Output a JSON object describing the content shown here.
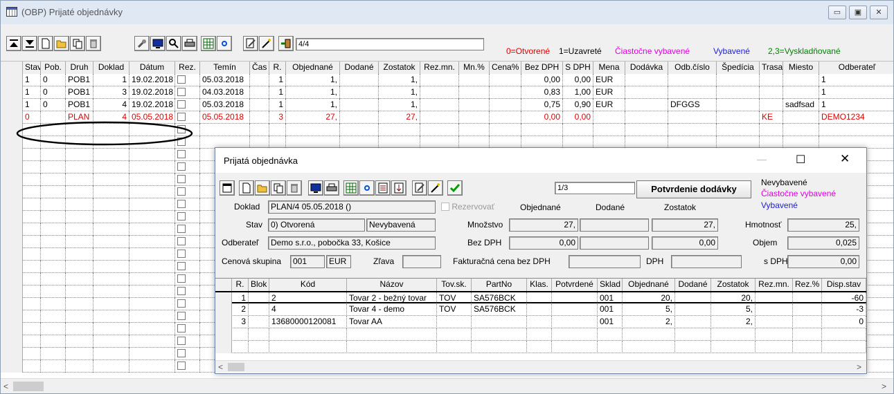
{
  "window": {
    "title": "(OBP) Prijaté objednávky",
    "icon": "table-window-icon"
  },
  "toolbar": {
    "counter": "4/4",
    "legend": [
      {
        "text": "0=Otvorené",
        "color": "#e00000"
      },
      {
        "text": "1=Uzavreté",
        "color": "#000000"
      },
      {
        "text": "Čiastočne vybavené",
        "color": "#e000e0"
      },
      {
        "text": "Vybavené",
        "color": "#2020d0"
      },
      {
        "text": "2,3=Vyskladňované",
        "color": "#008000"
      }
    ]
  },
  "grid": {
    "headers": [
      "Stav",
      "Pob.",
      "Druh",
      "Doklad",
      "Dátum",
      "Rez.",
      "Temín",
      "Čas",
      "R.",
      "Objednané",
      "Dodané",
      "Zostatok",
      "Rez.mn.",
      "Mn.%",
      "Cena%",
      "Bez DPH",
      "S DPH",
      "Mena",
      "Dodávka",
      "Odb.číslo",
      "Špedícia",
      "Trasa",
      "Miesto",
      "Odberateľ"
    ],
    "rows": [
      [
        "1",
        "0",
        "POB1",
        "1",
        "19.02.2018",
        "",
        "05.03.2018",
        "",
        "1",
        "1,",
        "",
        "1,",
        "",
        "",
        "",
        "0,00",
        "0,00",
        "EUR",
        "",
        "",
        "",
        "",
        "",
        "1"
      ],
      [
        "1",
        "0",
        "POB1",
        "3",
        "19.02.2018",
        "",
        "04.03.2018",
        "",
        "1",
        "1,",
        "",
        "1,",
        "",
        "",
        "",
        "0,83",
        "1,00",
        "EUR",
        "",
        "",
        "",
        "",
        "",
        "1"
      ],
      [
        "1",
        "0",
        "POB1",
        "4",
        "19.02.2018",
        "",
        "05.03.2018",
        "",
        "1",
        "1,",
        "",
        "1,",
        "",
        "",
        "",
        "0,75",
        "0,90",
        "EUR",
        "",
        "DFGGS",
        "",
        "",
        "sadfsad",
        "1"
      ],
      [
        "0",
        "",
        "PLAN",
        "4",
        "05.05.2018",
        "",
        "05.05.2018",
        "",
        "3",
        "27,",
        "",
        "27,",
        "",
        "",
        "",
        "0,00",
        "0,00",
        "",
        "",
        "",
        "",
        "KE",
        "",
        "DEMO1234"
      ]
    ]
  },
  "dialog": {
    "title": "Prijatá objednávka",
    "counter": "1/3",
    "confirm_button": "Potvrdenie dodávky",
    "status_legend": [
      "Nevybavené",
      "Čiastočne vybavené",
      "Vybavené"
    ],
    "doklad_label": "Doklad",
    "doklad_value": "PLAN/4 05.05.2018 ()",
    "rezervovat_label": "Rezervovať",
    "col_objednane": "Objednané",
    "col_dodane": "Dodané",
    "col_zostatok": "Zostatok",
    "stav_label": "Stav",
    "stav_value": "0) Otvorená",
    "stav_value2": "Nevybavená",
    "mnozstvo_label": "Množstvo",
    "mnozstvo_obj": "27,",
    "mnozstvo_zost": "27,",
    "hmotnost_label": "Hmotnosť",
    "hmotnost_value": "25,",
    "odberatel_label": "Odberateľ",
    "odberatel_value": "Demo s.r.o., pobočka 33, Košice",
    "bezdph_label": "Bez DPH",
    "bezdph_obj": "0,00",
    "bezdph_zost": "0,00",
    "objem_label": "Objem",
    "objem_value": "0,025",
    "cenova_label": "Cenová skupina",
    "cenova_value": "001",
    "mena_value": "EUR",
    "zlava_label": "Zľava",
    "fakt_label": "Fakturačná cena bez DPH",
    "dph_label": "DPH",
    "sdph_label": "s DPH",
    "sdph_value": "0,00",
    "items_headers": [
      "R.",
      "Blok",
      "Kód",
      "Názov",
      "Tov.sk.",
      "PartNo",
      "Klas.",
      "Potvrdené",
      "Sklad",
      "Objednané",
      "Dodané",
      "Zostatok",
      "Rez.mn.",
      "Rez.%",
      "Disp.stav"
    ],
    "items": [
      [
        "1",
        "",
        "2",
        "Tovar 2 - bežný tovar",
        "TOV",
        "SA576BCK",
        "",
        "",
        "001",
        "20,",
        "",
        "20,",
        "",
        "",
        "-60"
      ],
      [
        "2",
        "",
        "4",
        "Tovar 4 - demo",
        "TOV",
        "SA576BCK",
        "",
        "",
        "001",
        "5,",
        "",
        "5,",
        "",
        "",
        "-3"
      ],
      [
        "3",
        "",
        "13680000120081",
        "Tovar AA",
        "",
        "",
        "",
        "",
        "001",
        "2,",
        "",
        "2,",
        "",
        "",
        "0"
      ]
    ]
  }
}
